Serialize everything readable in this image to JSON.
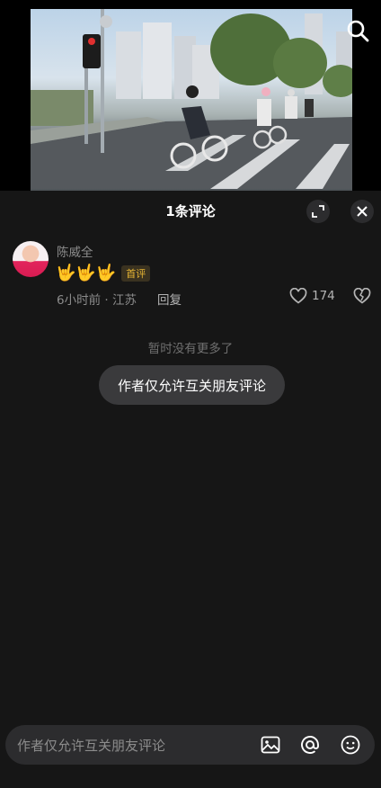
{
  "panel": {
    "title": "1条评论",
    "expand_icon": "expand-icon",
    "close_icon": "close-icon"
  },
  "comment": {
    "author": "陈威全",
    "content": "🤟🤟🤟",
    "badge": "首评",
    "meta": "6小时前 · 江苏",
    "reply": "回复",
    "likes": "174"
  },
  "no_more": "暂时没有更多了",
  "toast": "作者仅允许互关朋友评论",
  "input": {
    "placeholder": "作者仅允许互关朋友评论"
  },
  "colors": {
    "panel_bg": "#161616",
    "badge_text": "#e8b634",
    "muted_text": "#8c8c8c"
  }
}
